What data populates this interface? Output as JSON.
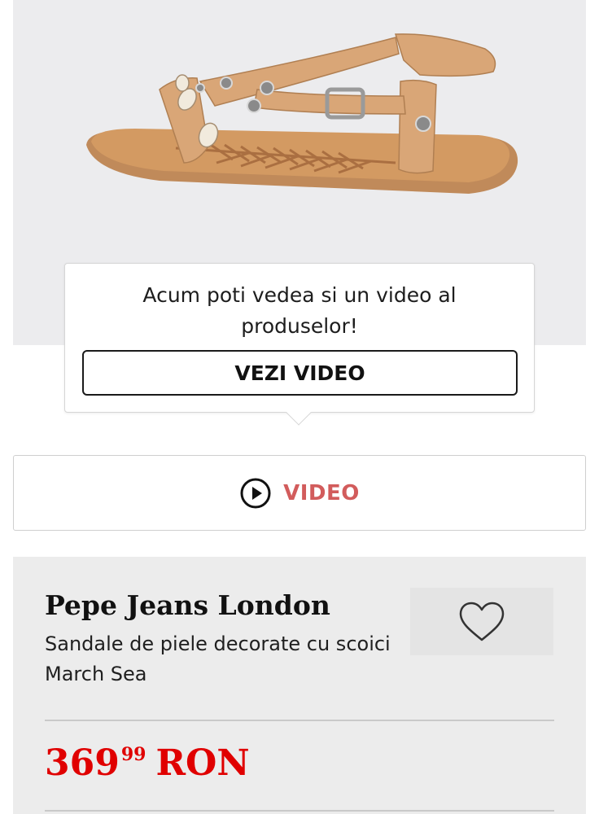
{
  "tooltip": {
    "text": "Acum poti vedea si un video al produselor!",
    "button_label": "VEZI VIDEO"
  },
  "video_button": {
    "label": "VIDEO",
    "icon": "play-circle-icon",
    "label_color": "#d25c5c"
  },
  "product": {
    "brand": "Pepe Jeans London",
    "title": "Sandale de piele decorate cu scoici March Sea",
    "price": {
      "integer": "369",
      "decimals": "99",
      "currency": "RON",
      "color": "#e00000"
    },
    "wishlist_icon": "heart-icon"
  }
}
